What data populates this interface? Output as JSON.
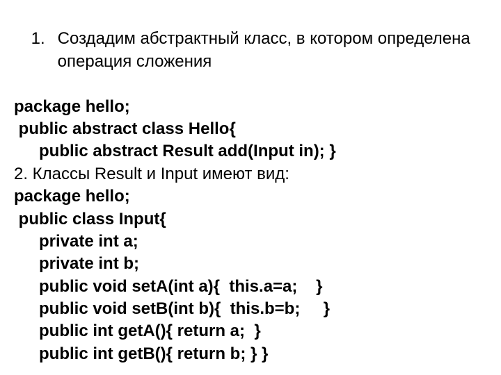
{
  "item1": {
    "number": "1.",
    "text": "Создадим  абстрактный класс, в котором определена операция сложения"
  },
  "code1": {
    "l1": "package hello;",
    "l2": " public abstract class Hello{",
    "l3": "public abstract Result add(Input in); }"
  },
  "item2": "2. Классы Result и Input имеют вид:",
  "code2": {
    "l1": "package hello;",
    "l2": " public class Input{",
    "l3": "private int a;",
    "l4": "private int b;",
    "l5": "public void setA(int a){  this.a=a;    }",
    "l6": "public void setB(int b){  this.b=b;     }",
    "l7": "public int getA(){ return a;  }",
    "l8": "public int getB(){ return b; } }"
  }
}
